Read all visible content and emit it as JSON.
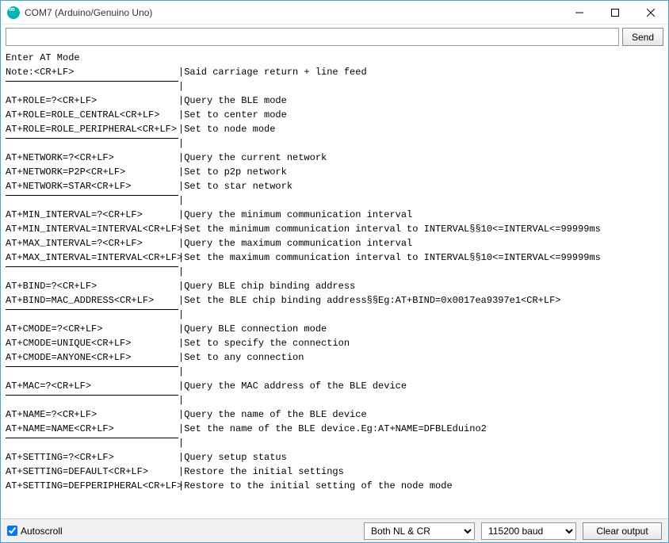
{
  "window": {
    "title": "COM7 (Arduino/Genuino Uno)"
  },
  "toolbar": {
    "send_label": "Send",
    "input_value": ""
  },
  "bottombar": {
    "autoscroll_label": "Autoscroll",
    "autoscroll_checked": true,
    "line_ending": "Both NL & CR",
    "baud": "115200 baud",
    "clear_label": "Clear output"
  },
  "output": {
    "intro": "Enter AT Mode",
    "sections": [
      {
        "rows": [
          {
            "cmd": "Note:<CR+LF>",
            "desc": "|Said carriage return + line feed"
          }
        ]
      },
      {
        "rows": [
          {
            "cmd": "AT+ROLE=?<CR+LF>",
            "desc": "|Query the BLE mode"
          },
          {
            "cmd": "AT+ROLE=ROLE_CENTRAL<CR+LF>",
            "desc": "|Set to center mode"
          },
          {
            "cmd": "AT+ROLE=ROLE_PERIPHERAL<CR+LF>",
            "desc": "|Set to node mode"
          }
        ]
      },
      {
        "rows": [
          {
            "cmd": "AT+NETWORK=?<CR+LF>",
            "desc": "|Query the current network"
          },
          {
            "cmd": "AT+NETWORK=P2P<CR+LF>",
            "desc": "|Set to p2p network"
          },
          {
            "cmd": "AT+NETWORK=STAR<CR+LF>",
            "desc": "|Set to star network"
          }
        ]
      },
      {
        "rows": [
          {
            "cmd": "AT+MIN_INTERVAL=?<CR+LF>",
            "desc": "|Query the minimum communication interval"
          },
          {
            "cmd": "AT+MIN_INTERVAL=INTERVAL<CR+LF>",
            "desc": "|Set the minimum communication interval to INTERVAL§§10<=INTERVAL<=99999ms"
          },
          {
            "cmd": "AT+MAX_INTERVAL=?<CR+LF>",
            "desc": "|Query the maximum communication interval"
          },
          {
            "cmd": "AT+MAX_INTERVAL=INTERVAL<CR+LF>",
            "desc": "|Set the maximum communication interval to INTERVAL§§10<=INTERVAL<=99999ms"
          }
        ]
      },
      {
        "rows": [
          {
            "cmd": "AT+BIND=?<CR+LF>",
            "desc": "|Query BLE chip binding address"
          },
          {
            "cmd": "AT+BIND=MAC_ADDRESS<CR+LF>",
            "desc": "|Set the BLE chip binding address§§Eg:AT+BIND=0x0017ea9397e1<CR+LF>"
          }
        ]
      },
      {
        "rows": [
          {
            "cmd": "AT+CMODE=?<CR+LF>",
            "desc": "|Query BLE connection mode"
          },
          {
            "cmd": "AT+CMODE=UNIQUE<CR+LF>",
            "desc": "|Set to specify the connection"
          },
          {
            "cmd": "AT+CMODE=ANYONE<CR+LF>",
            "desc": "|Set to any connection"
          }
        ]
      },
      {
        "rows": [
          {
            "cmd": "AT+MAC=?<CR+LF>",
            "desc": "|Query the MAC address of the BLE device"
          }
        ]
      },
      {
        "rows": [
          {
            "cmd": "AT+NAME=?<CR+LF>",
            "desc": "|Query the name of the BLE device"
          },
          {
            "cmd": "AT+NAME=NAME<CR+LF>",
            "desc": "|Set the name of the BLE device.Eg:AT+NAME=DFBLEduino2"
          }
        ]
      },
      {
        "rows": [
          {
            "cmd": "AT+SETTING=?<CR+LF>",
            "desc": "|Query setup status"
          },
          {
            "cmd": "AT+SETTING=DEFAULT<CR+LF>",
            "desc": "|Restore the initial settings"
          },
          {
            "cmd": "AT+SETTING=DEFPERIPHERAL<CR+LF>",
            "desc": "|Restore to the initial setting of the node mode"
          }
        ]
      }
    ]
  }
}
